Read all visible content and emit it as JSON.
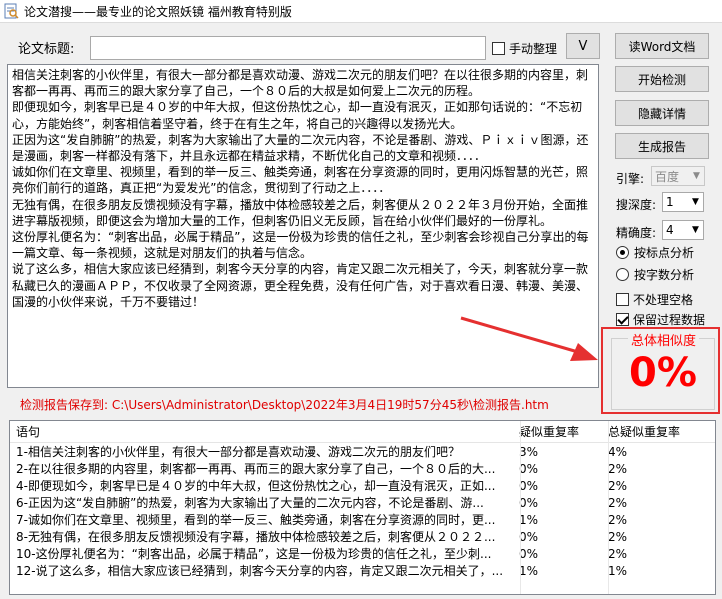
{
  "window": {
    "title": "论文潜搜——最专业的论文照妖镜 福州教育特别版"
  },
  "header": {
    "title_label": "论文标题:",
    "title_value": "",
    "manual_label": "手动整理",
    "manual_checked": false,
    "dropdown_label": "V"
  },
  "content": {
    "paragraphs": [
      "相信关注刺客的小伙伴里，有很大一部分都是喜欢动漫、游戏二次元的朋友们吧？在以往很多期的内容里，刺客都一再再、再而三的跟大家分享了自己，一个８０后的大叔是如何爱上二次元的历程。",
      "即便现如今，刺客早已是４０岁的中年大叔，但这份热忱之心，却一直没有泯灭，正如那句话说的：“不忘初心，方能始终”，刺客相信着坚守着，终于在有生之年，将自己的兴趣得以发扬光大。",
      "正因为这“发自肺腑”的热爱，刺客为大家输出了大量的二次元内容，不论是番剧、游戏、Ｐｉｘｉｖ图源，还是漫画，刺客一样都没有落下，并且永远都在精益求精，不断优化自己的文章和视频．．．．",
      "诚如你们在文章里、视频里，看到的举一反三、触类旁通，刺客在分享资源的同时，更用闪烁智慧的光芒，照亮你们前行的道路，真正把“为爱发光”的信念，贯彻到了行动之上．．．．",
      "无独有偶，在很多朋友反馈视频没有字幕，播放中体检感较差之后，刺客便从２０２２年３月份开始，全面推进字幕版视频，即便这会为增加大量的工作，但刺客仍旧义无反顾，旨在给小伙伴们最好的一份厚礼。",
      "这份厚礼便名为：“刺客出品，必属于精品”，这是一份极为珍贵的信任之礼，至少刺客会珍视自己分享出的每一篇文章、每一条视频，这就是对朋友们的执着与信念。",
      "说了这么多，相信大家应该已经猜到，刺客今天分享的内容，肯定又跟二次元相关了，今天，刺客就分享一款私藏已久的漫画ＡＰＰ，不仅收录了全网资源，更全程免费，没有任何广告，对于喜欢看日漫、韩漫、美漫、国漫的小伙伴来说，千万不要错过！"
    ]
  },
  "sidebar": {
    "read_word": "读Word文档",
    "start_check": "开始检测",
    "hide_detail": "隐藏详情",
    "gen_report": "生成报告",
    "engine_label": "引擎:",
    "engine_value": "百度",
    "depth_label": "搜深度:",
    "depth_value": "1",
    "precision_label": "精确度:",
    "precision_value": "4",
    "radio_sentence": "按标点分析",
    "radio_words": "按字数分析",
    "no_space_label": "不处理空格",
    "no_space_checked": false,
    "keep_data_label": "保留过程数据",
    "keep_data_checked": true
  },
  "similarity": {
    "title": "总体相似度",
    "value": "0%"
  },
  "report": {
    "text": "检测报告保存到: C:\\Users\\Administrator\\Desktop\\2022年3月4日19时57分45秒\\检测报告.htm"
  },
  "table": {
    "headers": [
      "语句",
      "疑似重复率",
      "总疑似重复率"
    ],
    "rows": [
      [
        "1-相信关注刺客的小伙伴里，有很大一部分都是喜欢动漫、游戏二次元的朋友们吧？",
        "3%",
        "4%"
      ],
      [
        "2-在以往很多期的内容里，刺客都一再再、再而三的跟大家分享了自己，一个８０后的大...",
        "0%",
        "2%"
      ],
      [
        "4-即便现如今，刺客早已是４０岁的中年大叔，但这份热忱之心，却一直没有泯灭，正如...",
        "0%",
        "2%"
      ],
      [
        "6-正因为这“发自肺腑”的热爱，刺客为大家输出了大量的二次元内容，不论是番剧、游...",
        "0%",
        "2%"
      ],
      [
        "7-诚如你们在文章里、视频里，看到的举一反三、触类旁通，刺客在分享资源的同时，更...",
        "1%",
        "2%"
      ],
      [
        "8-无独有偶，在很多朋友反馈视频没有字幕，播放中体检感较差之后，刺客便从２０２２...",
        "0%",
        "2%"
      ],
      [
        "10-这份厚礼便名为：“刺客出品，必属于精品”，这是一份极为珍贵的信任之礼，至少刺...",
        "0%",
        "2%"
      ],
      [
        "12-说了这么多，相信大家应该已经猜到，刺客今天分享的内容，肯定又跟二次元相关了，...",
        "1%",
        "1%"
      ]
    ]
  },
  "colors": {
    "accent_red": "#e53030",
    "similarity_red": "#ff0000",
    "report_red": "#e00000"
  }
}
